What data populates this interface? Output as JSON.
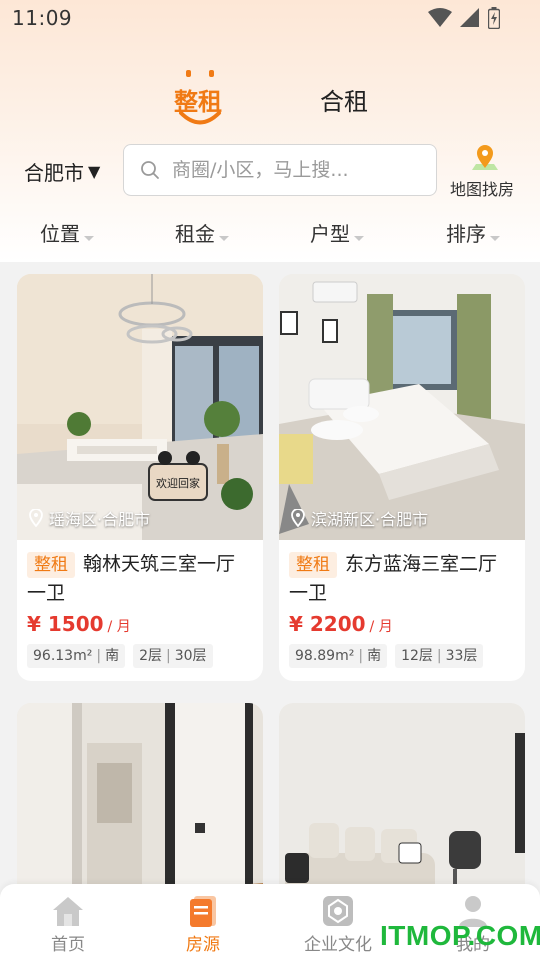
{
  "status_bar": {
    "time": "11:09"
  },
  "tabs": [
    {
      "label": "整租",
      "active": true
    },
    {
      "label": "合租",
      "active": false
    }
  ],
  "search": {
    "city": "合肥市",
    "city_caret": "▼",
    "placeholder": "商圈/小区，马上搜...",
    "map_label": "地图找房"
  },
  "filters": [
    "位置",
    "租金",
    "户型",
    "排序"
  ],
  "listings": [
    {
      "location": "瑶海区·合肥市",
      "badge": "整租",
      "title": "翰林天筑三室一厅一卫",
      "price": "¥ 1500",
      "unit": "/ 月",
      "area": "96.13m²",
      "orientation": "南",
      "floor": "2层",
      "total_floors": "30层",
      "photo_text": "欢迎回家"
    },
    {
      "location": "滨湖新区·合肥市",
      "badge": "整租",
      "title": "东方蓝海三室二厅一卫",
      "price": "¥ 2200",
      "unit": "/ 月",
      "area": "98.89m²",
      "orientation": "南",
      "floor": "12层",
      "total_floors": "33层"
    },
    {},
    {}
  ],
  "bottom_nav": [
    {
      "label": "首页",
      "icon": "home-icon",
      "active": false
    },
    {
      "label": "房源",
      "icon": "listings-icon",
      "active": true
    },
    {
      "label": "企业文化",
      "icon": "culture-icon",
      "active": false
    },
    {
      "label": "我的",
      "icon": "profile-icon",
      "active": false
    }
  ],
  "watermark": "ITMOP.COM",
  "colors": {
    "accent": "#f07a14",
    "price": "#e53a2f",
    "watermark": "#1fb83c"
  }
}
